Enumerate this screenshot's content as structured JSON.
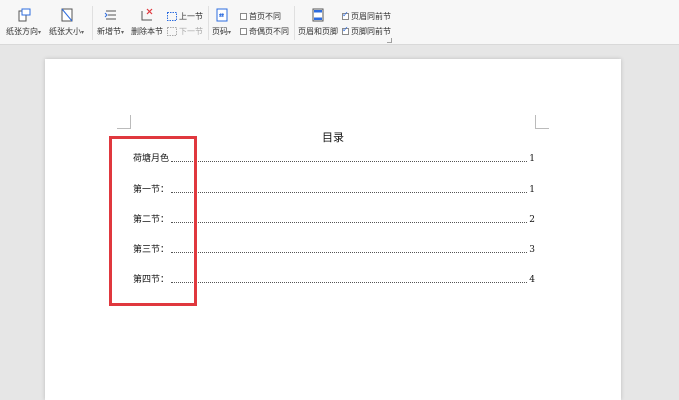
{
  "toolbar": {
    "orientation_label": "纸张方向",
    "size_label": "纸张大小",
    "new_section_label": "新增节",
    "delete_section_label": "删除本节",
    "prev_section_label": "上一节",
    "next_section_label": "下一节",
    "page_number_label": "页码",
    "first_page_diff_label": "首页不同",
    "odd_even_diff_label": "奇偶页不同",
    "header_footer_label": "页眉和页脚",
    "same_header_label": "页眉同前节",
    "same_footer_label": "页脚同前节",
    "dropdown_arrow": "▾"
  },
  "document": {
    "title": "目录",
    "toc": [
      {
        "label": "荷塘月色",
        "page": "1"
      },
      {
        "label": "第一节：",
        "page": "1"
      },
      {
        "label": "第二节：",
        "page": "2"
      },
      {
        "label": "第三节：",
        "page": "3"
      },
      {
        "label": "第四节：",
        "page": "4"
      }
    ]
  },
  "colors": {
    "highlight": "#e0383e",
    "accent": "#2d6cdf"
  }
}
